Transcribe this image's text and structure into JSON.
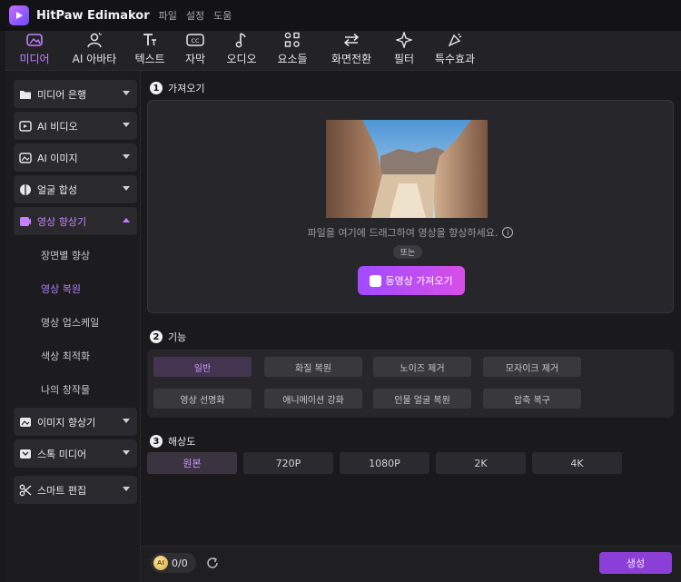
{
  "app": {
    "title": "HitPaw Edimakor",
    "menu": [
      "파일",
      "설정",
      "도움"
    ]
  },
  "toolbar": [
    {
      "label": "미디어",
      "icon": "media-icon",
      "active": true
    },
    {
      "label": "AI 아바타",
      "icon": "avatar-icon",
      "active": false
    },
    {
      "label": "텍스트",
      "icon": "text-icon",
      "active": false
    },
    {
      "label": "자막",
      "icon": "caption-icon",
      "active": false
    },
    {
      "label": "오디오",
      "icon": "music-note-icon",
      "active": false
    },
    {
      "label": "요소들",
      "icon": "elements-icon",
      "active": false
    },
    {
      "label": "화면전환",
      "icon": "transition-icon",
      "active": false
    },
    {
      "label": "필터",
      "icon": "filter-icon",
      "active": false
    },
    {
      "label": "특수효과",
      "icon": "effects-icon",
      "active": false
    }
  ],
  "sidebar": {
    "items": [
      {
        "label": "미디어 은행",
        "icon": "folder-icon"
      },
      {
        "label": "AI 비디오",
        "icon": "ai-video-icon"
      },
      {
        "label": "AI  이미지",
        "icon": "ai-image-icon"
      },
      {
        "label": "얼굴 합성",
        "icon": "face-swap-icon"
      },
      {
        "label": "영상 향상기",
        "icon": "video-enhance-icon",
        "open": true
      },
      {
        "label": "이미지 향상기",
        "icon": "image-enhance-icon"
      },
      {
        "label": "스톡 미디어",
        "icon": "stock-media-icon"
      },
      {
        "label": "스마트 편집",
        "icon": "smart-edit-icon"
      }
    ],
    "sub_items": [
      {
        "label": "장면별 향상"
      },
      {
        "label": "영상 복원",
        "active": true
      },
      {
        "label": "영상 업스케일"
      },
      {
        "label": "색상 최적화"
      },
      {
        "label": "나의 창작물"
      }
    ]
  },
  "import_section": {
    "title": "가져오기",
    "hint": "파일을 여기에 드래그하여 영상을 향상하세요.",
    "or_label": "또는",
    "button_label": "동영상 가져오기"
  },
  "function_section": {
    "title": "기능",
    "options": [
      "일반",
      "화질 복원",
      "노이즈 제거",
      "모자이크 제거",
      "영상 선명화",
      "애니메이션 강화",
      "인물 얼굴 복원",
      "압축 복구"
    ],
    "selected": "일반"
  },
  "resolution_section": {
    "title": "해상도",
    "options": [
      "원본",
      "720P",
      "1080P",
      "2K",
      "4K"
    ],
    "selected": "원본"
  },
  "footer": {
    "coin_label": "AI",
    "credits": "0/0",
    "generate_label": "생성"
  },
  "colors": {
    "accent": "#c580ff",
    "button_gradient_start": "#a14bff",
    "button_gradient_end": "#d74fe6",
    "generate": "#8b3fd6"
  }
}
